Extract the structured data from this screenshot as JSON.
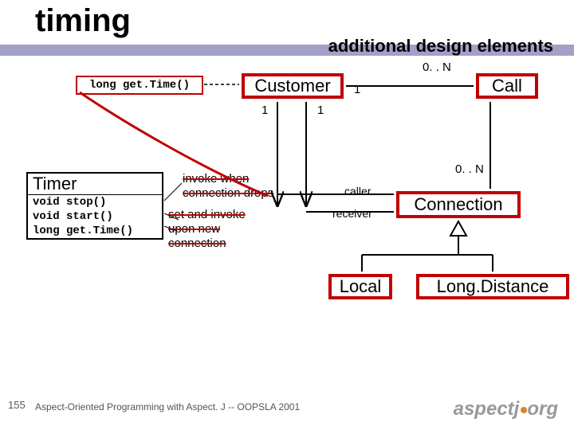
{
  "title": "timing",
  "subtitle": "additional design elements",
  "gettime_label": "long get.Time()",
  "classes": {
    "customer": "Customer",
    "call": "Call",
    "connection": "Connection",
    "local": "Local",
    "longdistance": "Long.Distance"
  },
  "timer": {
    "name": "Timer",
    "methods": [
      "void stop()",
      "void start()",
      "long get.Time()"
    ]
  },
  "multiplicities": {
    "customer_to_call_right": "0. . N",
    "customer_to_call_left": "1",
    "customer_to_conn_v": "1",
    "call_to_conn_v": "1",
    "conn_top": "0. . N"
  },
  "roles": {
    "caller": "caller",
    "receiver": "receiver"
  },
  "notes": {
    "invoke_l1": "invoke when",
    "invoke_l2": "connection drops",
    "set_l1": "set and invoke",
    "set_l2": "upon new",
    "set_l3": "connection"
  },
  "page_number": "155",
  "footer_text": "Aspect-Oriented Programming with Aspect. J -- OOPSLA 2001",
  "logo_text": "aspectj",
  "logo_suffix": "org"
}
